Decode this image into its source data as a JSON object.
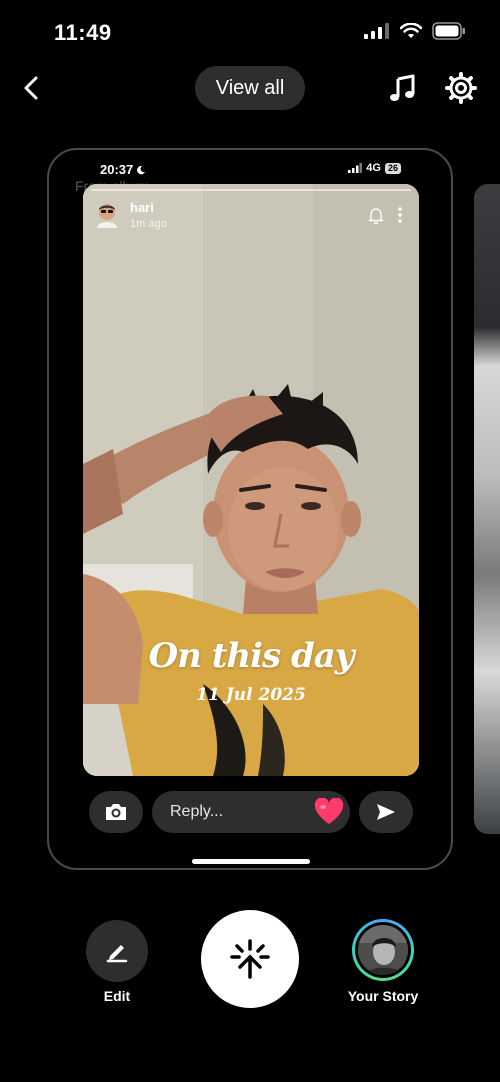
{
  "status_bar": {
    "time": "11:49"
  },
  "top_bar": {
    "view_all_label": "View all"
  },
  "preview": {
    "inner_time": "20:37",
    "inner_network": "4G",
    "inner_battery": "26",
    "source_label": "From album",
    "story": {
      "username": "hari",
      "time_ago": "1m ago",
      "title": "On this day",
      "date": "11 Jul 2025"
    },
    "reply_placeholder": "Reply..."
  },
  "bottom_actions": {
    "edit_label": "Edit",
    "your_story_label": "Your Story"
  },
  "colors": {
    "background": "#000000",
    "pill": "#2e2e30",
    "heart": "#ff3b6b",
    "story_ring": "#37d2c2"
  },
  "icons": [
    "chevron-left-icon",
    "music-note-icon",
    "gear-icon",
    "bell-icon",
    "more-vertical-icon",
    "camera-icon",
    "heart-icon",
    "send-icon",
    "pencil-icon",
    "capture-spark-icon"
  ]
}
